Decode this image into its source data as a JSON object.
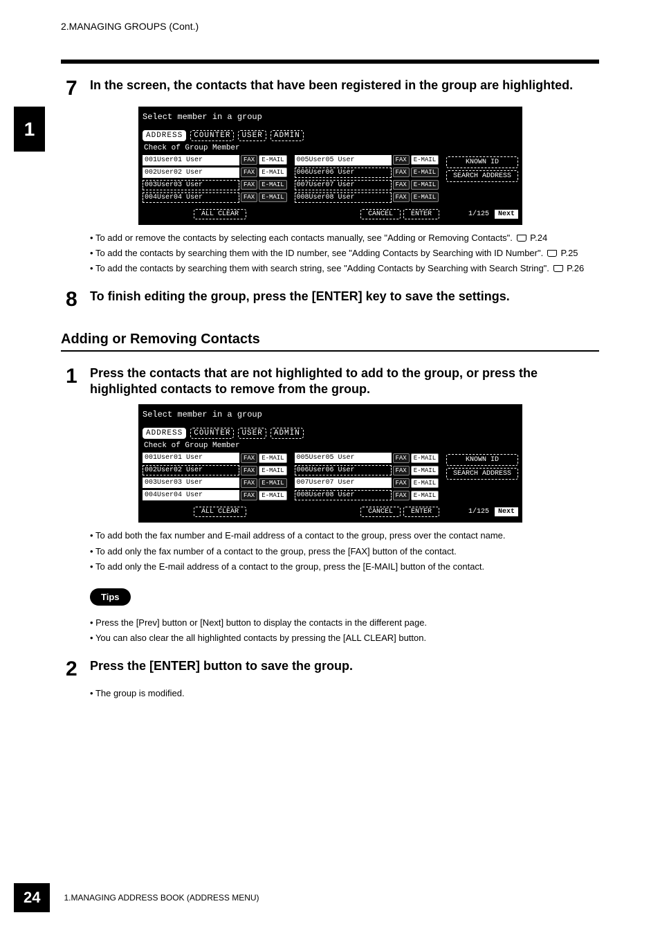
{
  "header": {
    "running_title": "2.MANAGING GROUPS (Cont.)"
  },
  "side_tab": "1",
  "step7": {
    "num": "7",
    "text": "In the screen, the contacts that have been registered in the group are highlighted.",
    "screenshot": {
      "title": "Select member in a group",
      "tabs": [
        "ADDRESS",
        "COUNTER",
        "USER",
        "ADMIN"
      ],
      "active_tab": 0,
      "subtitle": "Check of Group Member",
      "rows_left": [
        {
          "id": "001",
          "name": "User01 User",
          "selected": true,
          "email_sel": true
        },
        {
          "id": "002",
          "name": "User02 User",
          "selected": true,
          "email_sel": true
        },
        {
          "id": "003",
          "name": "User03 User",
          "selected": false,
          "email_sel": false
        },
        {
          "id": "004",
          "name": "User04 User",
          "selected": false,
          "email_sel": false
        }
      ],
      "rows_right": [
        {
          "id": "005",
          "name": "User05 User",
          "selected": true,
          "email_sel": true
        },
        {
          "id": "006",
          "name": "User06 User",
          "selected": false,
          "email_sel": false
        },
        {
          "id": "007",
          "name": "User07 User",
          "selected": false,
          "email_sel": false
        },
        {
          "id": "008",
          "name": "User08 User",
          "selected": false,
          "email_sel": false
        }
      ],
      "fax_label": "FAX",
      "email_label": "E-MAIL",
      "side_buttons": [
        "KNOWN ID",
        "SEARCH ADDRESS"
      ],
      "bottom": {
        "all_clear": "ALL CLEAR",
        "cancel": "CANCEL",
        "enter": "ENTER",
        "page": "1/125",
        "next": "Next"
      }
    },
    "bullets": [
      {
        "text_a": "To add or remove the contacts by selecting each contacts manually, see \"Adding or Removing Contacts\".",
        "ref": "P.24"
      },
      {
        "text_a": "To add the contacts by searching them with the ID number, see \"Adding Contacts by Searching with ID Number\".",
        "ref": "P.25"
      },
      {
        "text_a": "To add the contacts by searching them with search string, see \"Adding Contacts by Searching with Search String\".",
        "ref": "P.26"
      }
    ]
  },
  "step8": {
    "num": "8",
    "text": "To finish editing the group, press the [ENTER] key to save the settings."
  },
  "section": {
    "title": "Adding or Removing Contacts",
    "step1": {
      "num": "1",
      "text": "Press the contacts that are not highlighted to add to the group, or press the highlighted contacts to remove from the group.",
      "screenshot": {
        "title": "Select member in a group",
        "tabs": [
          "ADDRESS",
          "COUNTER",
          "USER",
          "ADMIN"
        ],
        "active_tab": 0,
        "subtitle": "Check of Group Member",
        "rows_left": [
          {
            "id": "001",
            "name": "User01 User",
            "selected": true,
            "email_sel": true
          },
          {
            "id": "002",
            "name": "User02 User",
            "selected": false,
            "email_sel": true
          },
          {
            "id": "003",
            "name": "User03 User",
            "selected": true,
            "email_sel": false
          },
          {
            "id": "004",
            "name": "User04 User",
            "selected": true,
            "email_sel": true
          }
        ],
        "rows_right": [
          {
            "id": "005",
            "name": "User05 User",
            "selected": true,
            "email_sel": true
          },
          {
            "id": "006",
            "name": "User06 User",
            "selected": false,
            "email_sel": true
          },
          {
            "id": "007",
            "name": "User07 User",
            "selected": true,
            "email_sel": true
          },
          {
            "id": "008",
            "name": "User08 User",
            "selected": false,
            "email_sel": true
          }
        ],
        "fax_label": "FAX",
        "email_label": "E-MAIL",
        "side_buttons": [
          "KNOWN ID",
          "SEARCH ADDRESS"
        ],
        "bottom": {
          "all_clear": "ALL CLEAR",
          "cancel": "CANCEL",
          "enter": "ENTER",
          "page": "1/125",
          "next": "Next"
        }
      },
      "bullets": [
        "To add both the fax number and E-mail address of a contact to the group, press over the contact name.",
        "To add only the fax number of a contact to the group, press the [FAX] button of the contact.",
        "To add only the E-mail address of a contact to the group, press the [E-MAIL] button of the contact."
      ]
    },
    "tips_label": "Tips",
    "tips": [
      "Press the [Prev] button or [Next] button to display the contacts in the different page.",
      "You can also clear the all highlighted contacts by pressing the [ALL CLEAR] button."
    ],
    "step2": {
      "num": "2",
      "text": "Press the [ENTER] button to save the group.",
      "bullet": "The group is modified."
    }
  },
  "footer": {
    "page_num": "24",
    "text": "1.MANAGING ADDRESS BOOK (ADDRESS MENU)"
  }
}
